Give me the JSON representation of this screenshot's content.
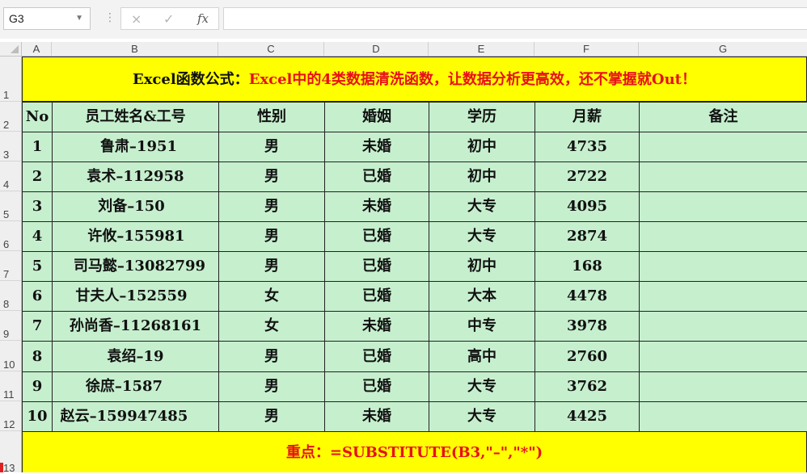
{
  "formula_bar": {
    "name_box": "G3",
    "cancel_icon": "×",
    "enter_icon": "✓",
    "fx_label": "fx",
    "formula": ""
  },
  "columns": [
    "A",
    "B",
    "C",
    "D",
    "E",
    "F",
    "G"
  ],
  "rows": [
    "1",
    "2",
    "3",
    "4",
    "5",
    "6",
    "7",
    "8",
    "9",
    "10",
    "11",
    "12",
    "13"
  ],
  "title": {
    "part1": "Excel函数公式：",
    "part2": "Excel中的4类数据清洗函数，让数据分析更高效，还不掌握就Out！"
  },
  "headers": [
    "No",
    "员工姓名&工号",
    "性别",
    "婚姻",
    "学历",
    "月薪",
    "备注"
  ],
  "records": [
    [
      "1",
      "鲁肃–1951",
      "男",
      "未婚",
      "初中",
      "4735",
      ""
    ],
    [
      "2",
      "袁术–112958",
      "男",
      "已婚",
      "初中",
      "2722",
      ""
    ],
    [
      "3",
      "刘备–150",
      "男",
      "未婚",
      "大专",
      "4095",
      ""
    ],
    [
      "4",
      "许攸–155981",
      "男",
      "已婚",
      "大专",
      "2874",
      ""
    ],
    [
      "5",
      "司马懿–13082799",
      "男",
      "已婚",
      "初中",
      "168",
      ""
    ],
    [
      "6",
      "甘夫人–152559",
      "女",
      "已婚",
      "大本",
      "4478",
      ""
    ],
    [
      "7",
      "孙尚香–11268161",
      "女",
      "未婚",
      "中专",
      "3978",
      ""
    ],
    [
      "8",
      "袁绍–19",
      "男",
      "已婚",
      "高中",
      "2760",
      ""
    ],
    [
      "9",
      "徐庶–1587",
      "男",
      "已婚",
      "大专",
      "3762",
      ""
    ],
    [
      "10",
      "赵云–159947485",
      "男",
      "未婚",
      "大专",
      "4425",
      ""
    ]
  ],
  "footer": "重点：=SUBSTITUTE(B3,\"–\",\"*\")",
  "colors": {
    "title_fill": "#ffff00",
    "data_fill": "#c6efce",
    "accent_red": "#e8101a"
  }
}
